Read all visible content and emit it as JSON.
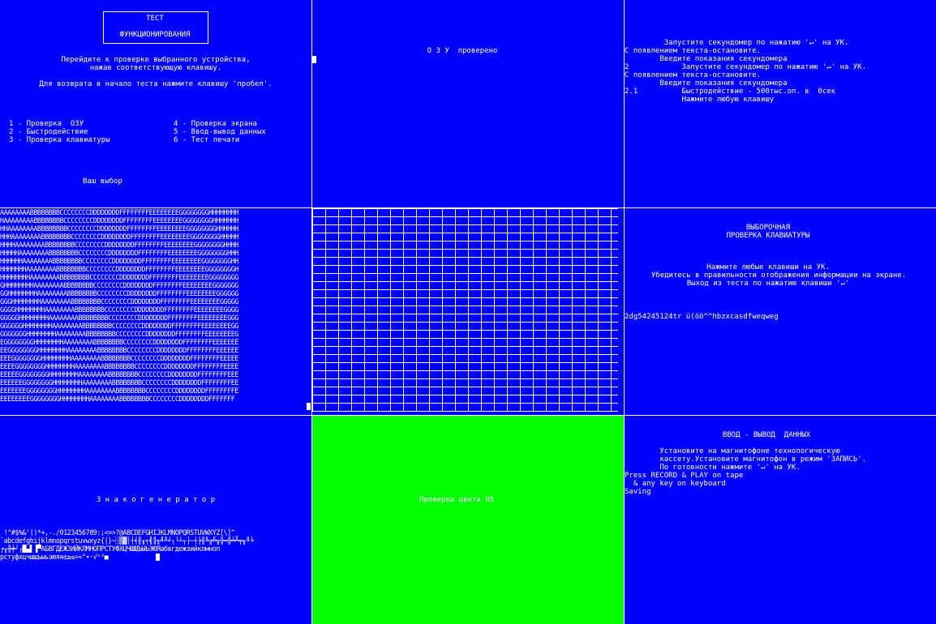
{
  "panel1": {
    "title_line1": "ТЕСТ",
    "title_line2": "ФУНКЦИОНИРОВАНИЯ",
    "instruction_line1": "Перейдите к проверке выбранного устройства,",
    "instruction_line2": "нажав соответствующую клавишу.",
    "return_line": "Для возврата в начало теста нажмите клавишу 'пробел'.",
    "menu": [
      "1 - Проверка  ОЗУ",
      "2 - Быстродействие",
      "3 - Проверка клавиатуры",
      "4 - Проверка экрана",
      "5 - Ввод-вывод данных",
      "6 - Тест печати"
    ],
    "prompt": "Ваш выбор"
  },
  "panel2": {
    "status": "О З У  проверено"
  },
  "panel3": {
    "lines": [
      "         Запустите секундомер по нажатию '↵' на УК.",
      "С появлением текста-остановите.",
      "        Введите показания секундомера",
      "2            Запустите секундомер по нажатию '↵' на УК.",
      "С появлением текста-остановите.",
      "        Введите показания секундомера",
      "2.1          Быстродействие - 500тыс.оп. в  0сек",
      "             Нажмите любую клавишу"
    ]
  },
  "panel4": {
    "rows": [
      "AAAAAAAABBBBBBBBCCCCCCCCDDDDDDDDFFFFFFFFEEEEEEEEGGGGGGGGHHHHHHHH",
      "HAAAAAAAABBBBBBBBCCCCCCCCDDDDDDDDFFFFFFFFEEEEEEEEGGGGGGGGHHHHHHH",
      "HHAAAAAAAABBBBBBBBCCCCCCCCDDDDDDDDFFFFFFFFEEEEEEEEGGGGGGGGHHHHHH",
      "HHHAAAAAAAABBBBBBBBCCCCCCCCDDDDDDDDFFFFFFFFEEEEEEEEGGGGGGGGHHHHH",
      "HHHHAAAAAAAABBBBBBBBCCCCCCCCDDDDDDDDFFFFFFFFEEEEEEEEGGGGGGGGHHHH",
      "HHHHHAAAAAAAABBBBBBBBCCCCCCCCDDDDDDDDFFFFFFFFEEEEEEEEGGGGGGGGHHH",
      "HHHHHHAAAAAAAABBBBBBBBCCCCCCCCDDDDDDDDFFFFFFFFEEEEEEEEGGGGGGGGHH",
      "HHHHHHHAAAAAAAABBBBBBBBCCCCCCCCDDDDDDDDFFFFFFFFEEEEEEEEGGGGGGGGH",
      "HHHHHHHHAAAAAAAABBBBBBBBCCCCCCCCDDDDDDDDFFFFFFFFEEEEEEEEGGGGGGGG",
      "GHHHHHHHHAAAAAAAABBBBBBBBCCCCCCCCDDDDDDDDFFFFFFFFEEEEEEEEGGGGGGG",
      "GGHHHHHHHHAAAAAAAABBBBBBBBCCCCCCCCDDDDDDDDFFFFFFFFEEEEEEEEGGGGGG",
      "GGGHHHHHHHHAAAAAAAABBBBBBBBCCCCCCCCDDDDDDDDFFFFFFFFEEEEEEEEGGGGG",
      "GGGGHHHHHHHHAAAAAAAABBBBBBBBCCCCCCCCDDDDDDDDFFFFFFFFEEEEEEEEGGGG",
      "GGGGGHHHHHHHHAAAAAAAABBBBBBBBCCCCCCCCDDDDDDDDFFFFFFFFEEEEEEEEGGG",
      "GGGGGGHHHHHHHHAAAAAAAABBBBBBBBCCCCCCCCDDDDDDDDFFFFFFFFEEEEEEEEGG",
      "GGGGGGGHHHHHHHHAAAAAAAABBBBBBBBCCCCCCCCDDDDDDDDFFFFFFFFEEEEEEEEG",
      "EGGGGGGGGHHHHHHHHAAAAAAAABBBBBBBBCCCCCCCCDDDDDDDDFFFFFFFFEEEEEEE",
      "EEGGGGGGGGHHHHHHHHAAAAAAAABBBBBBBBCCCCCCCCDDDDDDDDFFFFFFFFEEEEEE",
      "EEEGGGGGGGGHHHHHHHHAAAAAAAABBBBBBBBCCCCCCCCDDDDDDDDFFFFFFFFEEEEE",
      "EEEEGGGGGGGGHHHHHHHHAAAAAAAABBBBBBBBCCCCCCCCDDDDDDDDFFFFFFFFEEEE",
      "EEEEEGGGGGGGGHHHHHHHHAAAAAAAABBBBBBBBCCCCCCCCDDDDDDDDFFFFFFFFEEE",
      "EEEEEEGGGGGGGGHHHHHHHHAAAAAAAABBBBBBBBCCCCCCCCDDDDDDDDFFFFFFFFEE",
      "EEEEEEEGGGGGGGGHHHHHHHHAAAAAAAABBBBBBBBCCCCCCCCDDDDDDDDFFFFFFFFE",
      "EEEEEEEEGGGGGGGGHHHHHHHHAAAAAAAABBBBBBBBCCCCCCCCDDDDDDDDFFFFFFF"
    ]
  },
  "panel6": {
    "title_line1": "ВЫБОРОЧНАЯ",
    "title_line2": "ПРОВЕРКА КЛАВИАТУРЫ",
    "line1": "Нажмите любые клавиши на УК.",
    "line2": "Убедитесь в правильности отображения информации на экране.",
    "line3": "Выход из теста по нажатию клавиши '↵'",
    "typed": "2dg54245124tr ü(öö^^hbzxcasdfwеqwеg"
  },
  "panel7": {
    "title": "З н а к о г е н е р а т о р",
    "charset": [
      " !\"#$%&'()*+,-./0123456789:;<=>?@ABCDEFGHIJKLMNOPQRSTUVWXYZ[\\]^_",
      "`abcdefghijklmnopqrstuvwxyz{|}~░▒▓│┤╡╢╖╕╣║╗╝╜╛┐└┴┬├─┼╞╟╚╔╩╦╠═╬╧╨╤╥╙╘",
      "╒╓╫╪┘┌█▄▌▐▀АБВГДЕЖЗИЙКЛМНОПРСТУФХЦЧШЩЪЫЬЭЮЯабвгдежзийклмноп",
      "рстуфхцчшщъыьэюя≡±≥≤÷≈°∙·√ⁿ²■"
    ]
  },
  "panel8": {
    "text": "Проверка цвета 05",
    "color": "#00ff00"
  },
  "panel9": {
    "title": "ВВОД - ВЫВОД  ДАННЫХ",
    "lines": [
      "        Установите на магнитофоне технологическую",
      "        кассету.Установите магнитофон в режим 'ЗАПИСЬ'.",
      "        По готовности нажмите '↵' на УК.",
      "Press RECORD & PLAY on tape",
      "  & any key on keyboard",
      "Saving"
    ]
  },
  "colors": {
    "background": "#0000ff",
    "foreground": "#ffffff",
    "green": "#00ff00"
  }
}
